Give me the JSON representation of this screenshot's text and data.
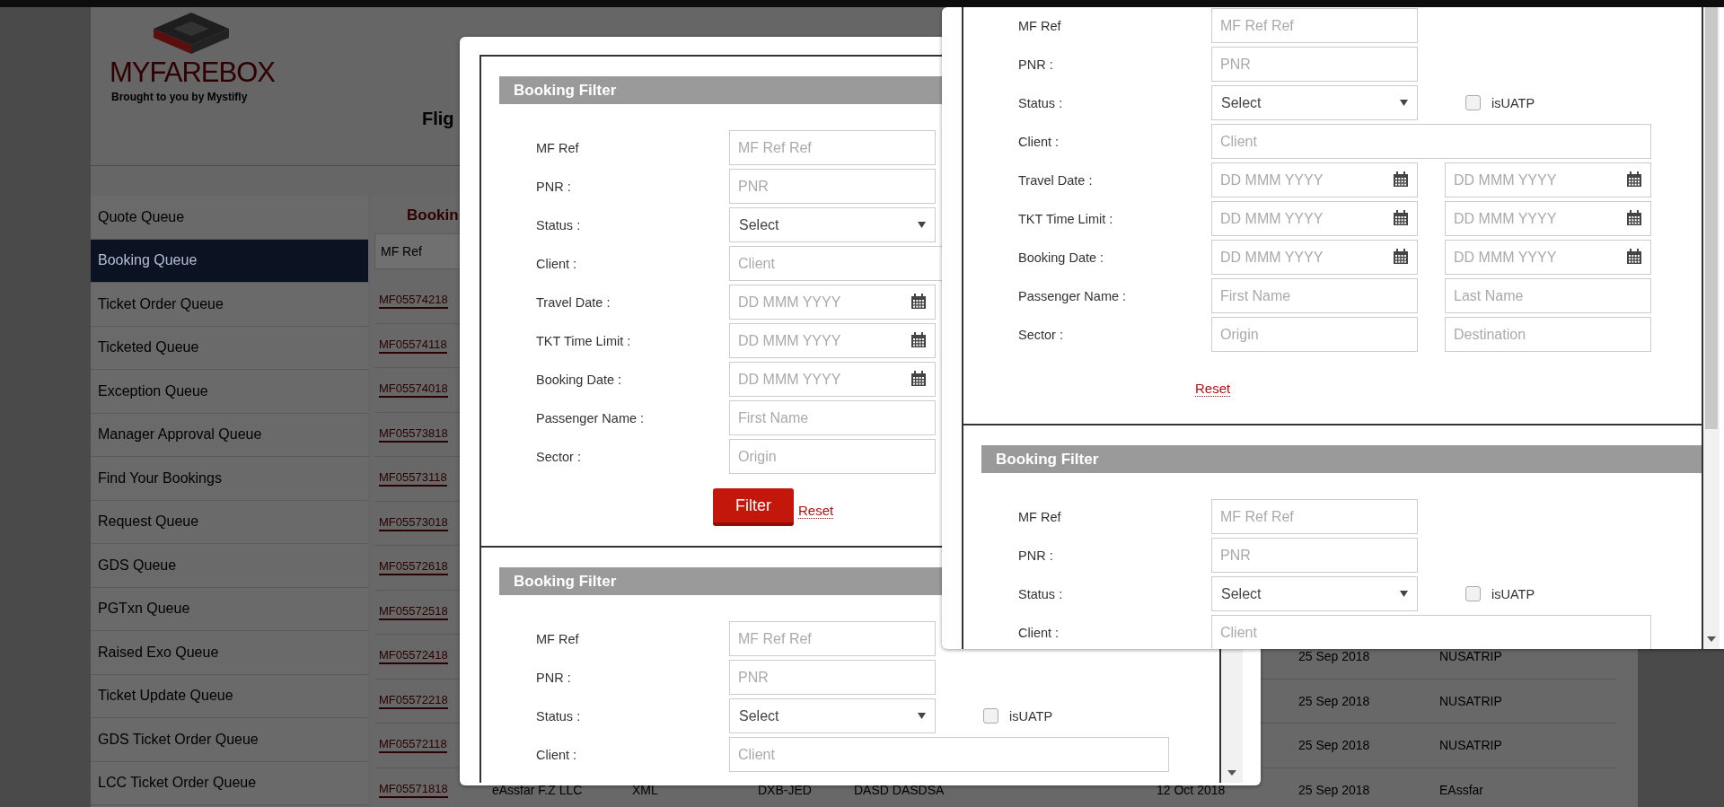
{
  "page": {
    "logo": {
      "brand": "MYFAREBOX",
      "tagline": "Brought to you by Mystifly"
    },
    "title": "Flig"
  },
  "sidebar": {
    "items": [
      {
        "label": "Quote Queue",
        "selected": false
      },
      {
        "label": "Booking Queue",
        "selected": true
      },
      {
        "label": "Ticket Order Queue",
        "selected": false
      },
      {
        "label": "Ticketed Queue",
        "selected": false
      },
      {
        "label": "Exception Queue",
        "selected": false
      },
      {
        "label": "Manager Approval Queue",
        "selected": false
      },
      {
        "label": "Find Your Bookings",
        "selected": false
      },
      {
        "label": "Request Queue",
        "selected": false
      },
      {
        "label": "GDS Queue",
        "selected": false
      },
      {
        "label": "PGTxn Queue",
        "selected": false
      },
      {
        "label": "Raised Exo Queue",
        "selected": false
      },
      {
        "label": "Ticket Update Queue",
        "selected": false
      },
      {
        "label": "GDS Ticket Order Queue",
        "selected": false
      },
      {
        "label": "LCC Ticket Order Queue",
        "selected": false
      }
    ]
  },
  "table": {
    "title": "Bookin",
    "columns": [
      "MF Ref"
    ],
    "rows": [
      {
        "mf_ref": "MF05574218"
      },
      {
        "mf_ref": "MF05574118"
      },
      {
        "mf_ref": "MF05574018"
      },
      {
        "mf_ref": "MF05573818"
      },
      {
        "mf_ref": "MF05573118"
      },
      {
        "mf_ref": "MF05573018"
      },
      {
        "mf_ref": "MF05572618"
      },
      {
        "mf_ref": "MF05572518"
      },
      {
        "mf_ref": "MF05572418",
        "column_7": "25 Sep 2018",
        "column_8": "NUSATRIP"
      },
      {
        "mf_ref": "MF05572218",
        "column_7": "25 Sep 2018",
        "column_8": "NUSATRIP"
      },
      {
        "mf_ref": "MF05572118",
        "column_7": "25 Sep 2018",
        "column_8": "NUSATRIP"
      },
      {
        "mf_ref": "MF05571818",
        "column_2": "eAssfar F.Z LLC",
        "column_3": "XML",
        "column_4": "DXB-JED",
        "column_5": "DASD DASDSA",
        "column_6": "12 Oct 2018",
        "column_7": "25 Sep 2018",
        "column_8": "EAssfar"
      }
    ]
  },
  "dialogs": [
    {
      "sections": [
        {
          "title": "Booking Filter",
          "fields": [
            {
              "label": "MF Ref",
              "inputs": [
                {
                  "kind": "text",
                  "placeholder": "MF Ref Ref"
                }
              ]
            },
            {
              "label": "PNR :",
              "inputs": [
                {
                  "kind": "text",
                  "placeholder": "PNR"
                }
              ]
            },
            {
              "label": "Status :",
              "inputs": [
                {
                  "kind": "select",
                  "value": "Select"
                }
              ]
            },
            {
              "label": "Client :",
              "inputs": [
                {
                  "kind": "wide",
                  "placeholder": "Client"
                }
              ]
            },
            {
              "label": "Travel Date :",
              "inputs": [
                {
                  "kind": "date",
                  "placeholder": "DD MMM YYYY"
                }
              ]
            },
            {
              "label": "TKT Time Limit :",
              "inputs": [
                {
                  "kind": "date",
                  "placeholder": "DD MMM YYYY"
                }
              ]
            },
            {
              "label": "Booking Date :",
              "inputs": [
                {
                  "kind": "date",
                  "placeholder": "DD MMM YYYY"
                }
              ]
            },
            {
              "label": "Passenger Name :",
              "inputs": [
                {
                  "kind": "text",
                  "placeholder": "First Name"
                }
              ]
            },
            {
              "label": "Sector :",
              "inputs": [
                {
                  "kind": "text",
                  "placeholder": "Origin"
                }
              ]
            }
          ],
          "actions": [
            {
              "kind": "button",
              "label": "Filter"
            },
            {
              "kind": "link",
              "label": "Reset"
            }
          ]
        },
        {
          "title": "Booking Filter",
          "fields": [
            {
              "label": "MF Ref",
              "inputs": [
                {
                  "kind": "text",
                  "placeholder": "MF Ref Ref"
                }
              ]
            },
            {
              "label": "PNR :",
              "inputs": [
                {
                  "kind": "text",
                  "placeholder": "PNR"
                }
              ]
            },
            {
              "label": "Status :",
              "inputs": [
                {
                  "kind": "select",
                  "value": "Select"
                }
              ],
              "checkbox": {
                "label": "isUATP",
                "checked": false
              }
            },
            {
              "label": "Client :",
              "inputs": [
                {
                  "kind": "wide",
                  "placeholder": "Client"
                }
              ]
            }
          ]
        }
      ]
    },
    {
      "sections": [
        {
          "fields": [
            {
              "label": "MF Ref",
              "inputs": [
                {
                  "kind": "text",
                  "placeholder": "MF Ref Ref"
                }
              ]
            },
            {
              "label": "PNR :",
              "inputs": [
                {
                  "kind": "text",
                  "placeholder": "PNR"
                }
              ]
            },
            {
              "label": "Status :",
              "inputs": [
                {
                  "kind": "select",
                  "value": "Select"
                }
              ],
              "checkbox": {
                "label": "isUATP",
                "checked": false
              }
            },
            {
              "label": "Client :",
              "inputs": [
                {
                  "kind": "wide",
                  "placeholder": "Client"
                }
              ]
            },
            {
              "label": "Travel Date :",
              "inputs": [
                {
                  "kind": "date",
                  "placeholder": "DD MMM YYYY"
                },
                {
                  "kind": "date",
                  "placeholder": "DD MMM YYYY"
                }
              ]
            },
            {
              "label": "TKT Time Limit :",
              "inputs": [
                {
                  "kind": "date",
                  "placeholder": "DD MMM YYYY"
                },
                {
                  "kind": "date",
                  "placeholder": "DD MMM YYYY"
                }
              ]
            },
            {
              "label": "Booking Date :",
              "inputs": [
                {
                  "kind": "date",
                  "placeholder": "DD MMM YYYY"
                },
                {
                  "kind": "date",
                  "placeholder": "DD MMM YYYY"
                }
              ]
            },
            {
              "label": "Passenger Name :",
              "inputs": [
                {
                  "kind": "text",
                  "placeholder": "First Name"
                },
                {
                  "kind": "text",
                  "placeholder": "Last Name"
                }
              ]
            },
            {
              "label": "Sector :",
              "inputs": [
                {
                  "kind": "text",
                  "placeholder": "Origin"
                },
                {
                  "kind": "text",
                  "placeholder": "Destination"
                }
              ]
            }
          ],
          "actions": [
            {
              "kind": "link",
              "label": "Reset"
            }
          ]
        },
        {
          "title": "Booking Filter",
          "fields": [
            {
              "label": "MF Ref",
              "inputs": [
                {
                  "kind": "text",
                  "placeholder": "MF Ref Ref"
                }
              ]
            },
            {
              "label": "PNR :",
              "inputs": [
                {
                  "kind": "text",
                  "placeholder": "PNR"
                }
              ]
            },
            {
              "label": "Status :",
              "inputs": [
                {
                  "kind": "select",
                  "value": "Select"
                }
              ],
              "checkbox": {
                "label": "isUATP",
                "checked": false
              }
            },
            {
              "label": "Client :",
              "inputs": [
                {
                  "kind": "wide",
                  "placeholder": "Client"
                }
              ]
            }
          ]
        }
      ]
    }
  ]
}
